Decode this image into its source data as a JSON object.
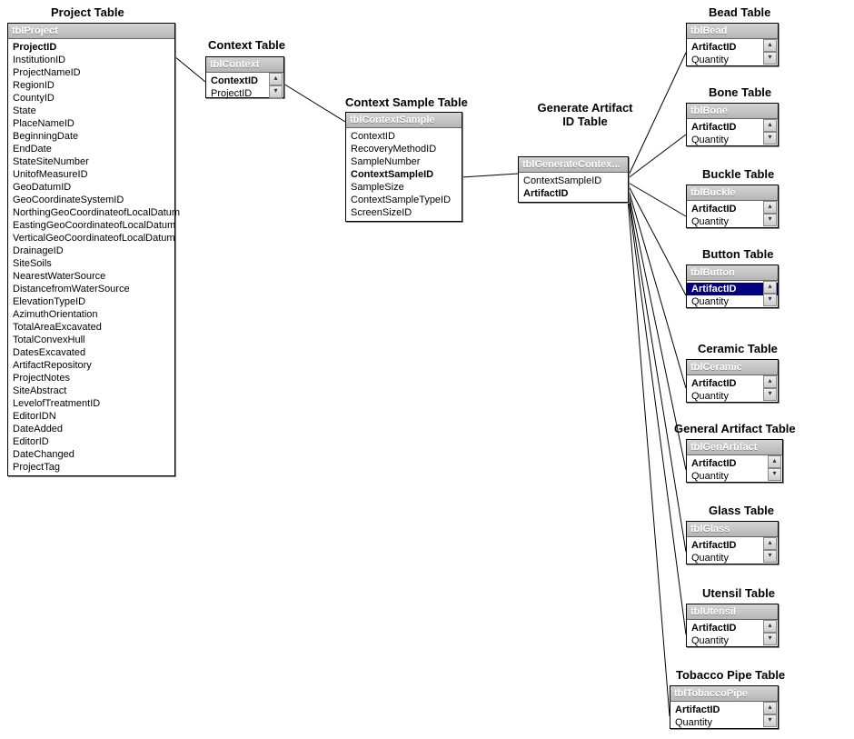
{
  "headings": {
    "project": "Project Table",
    "context": "Context Table",
    "contextSample": "Context Sample Table",
    "generate": "Generate Artifact ID Table",
    "bead": "Bead Table",
    "bone": "Bone Table",
    "buckle": "Buckle Table",
    "button": "Button Table",
    "ceramic": "Ceramic Table",
    "genArtifact": "General Artifact Table",
    "glass": "Glass Table",
    "utensil": "Utensil Table",
    "tobaccoPipe": "Tobacco Pipe Table"
  },
  "tables": {
    "project": {
      "name": "tblProject",
      "fields": [
        {
          "label": "ProjectID",
          "bold": true
        },
        {
          "label": "InstitutionID"
        },
        {
          "label": "ProjectNameID"
        },
        {
          "label": "RegionID"
        },
        {
          "label": "CountyID"
        },
        {
          "label": "State"
        },
        {
          "label": "PlaceNameID"
        },
        {
          "label": "BeginningDate"
        },
        {
          "label": "EndDate"
        },
        {
          "label": "StateSiteNumber"
        },
        {
          "label": "UnitofMeasureID"
        },
        {
          "label": "GeoDatumID"
        },
        {
          "label": "GeoCoordinateSystemID"
        },
        {
          "label": "NorthingGeoCoordinateofLocalDatum"
        },
        {
          "label": "EastingGeoCoordinateofLocalDatum"
        },
        {
          "label": "VerticalGeoCoordinateofLocalDatum"
        },
        {
          "label": "DrainageID"
        },
        {
          "label": "SiteSoils"
        },
        {
          "label": "NearestWaterSource"
        },
        {
          "label": "DistancefromWaterSource"
        },
        {
          "label": "ElevationTypeID"
        },
        {
          "label": "AzimuthOrientation"
        },
        {
          "label": "TotalAreaExcavated"
        },
        {
          "label": "TotalConvexHull"
        },
        {
          "label": "DatesExcavated"
        },
        {
          "label": "ArtifactRepository"
        },
        {
          "label": "ProjectNotes"
        },
        {
          "label": "SiteAbstract"
        },
        {
          "label": "LevelofTreatmentID"
        },
        {
          "label": "EditorIDN"
        },
        {
          "label": "DateAdded"
        },
        {
          "label": "EditorID"
        },
        {
          "label": "DateChanged"
        },
        {
          "label": "ProjectTag"
        }
      ]
    },
    "context": {
      "name": "tblContext",
      "fields": [
        {
          "label": "ContextID",
          "bold": true
        },
        {
          "label": "ProjectID"
        }
      ]
    },
    "contextSample": {
      "name": "tblContextSample",
      "fields": [
        {
          "label": "ContextID"
        },
        {
          "label": "RecoveryMethodID"
        },
        {
          "label": "SampleNumber"
        },
        {
          "label": "ContextSampleID",
          "bold": true
        },
        {
          "label": "SampleSize"
        },
        {
          "label": "ContextSampleTypeID"
        },
        {
          "label": "ScreenSizeID"
        }
      ]
    },
    "generate": {
      "name": "tblGenerateContex...",
      "fields": [
        {
          "label": "ContextSampleID"
        },
        {
          "label": "ArtifactID",
          "bold": true
        }
      ]
    },
    "bead": {
      "name": "tblBead",
      "fields": [
        {
          "label": "ArtifactID",
          "bold": true
        },
        {
          "label": "Quantity"
        }
      ]
    },
    "bone": {
      "name": "tblBone",
      "fields": [
        {
          "label": "ArtifactID",
          "bold": true
        },
        {
          "label": "Quantity"
        }
      ]
    },
    "buckle": {
      "name": "tblBuckle",
      "fields": [
        {
          "label": "ArtifactID",
          "bold": true
        },
        {
          "label": "Quantity"
        }
      ]
    },
    "button": {
      "name": "tblButton",
      "fields": [
        {
          "label": "ArtifactID",
          "bold": true,
          "selected": true
        },
        {
          "label": "Quantity"
        }
      ]
    },
    "ceramic": {
      "name": "tblCeramic",
      "fields": [
        {
          "label": "ArtifactID",
          "bold": true
        },
        {
          "label": "Quantity"
        }
      ]
    },
    "genArtifact": {
      "name": "tblGenArtifact",
      "fields": [
        {
          "label": "ArtifactID",
          "bold": true
        },
        {
          "label": "Quantity"
        }
      ]
    },
    "glass": {
      "name": "tblGlass",
      "fields": [
        {
          "label": "ArtifactID",
          "bold": true
        },
        {
          "label": "Quantity"
        }
      ]
    },
    "utensil": {
      "name": "tblUtensil",
      "fields": [
        {
          "label": "ArtifactID",
          "bold": true
        },
        {
          "label": "Quantity"
        }
      ]
    },
    "tobaccoPipe": {
      "name": "tblTobaccoPipe",
      "fields": [
        {
          "label": "ArtifactID",
          "bold": true
        },
        {
          "label": "Quantity"
        }
      ]
    }
  }
}
